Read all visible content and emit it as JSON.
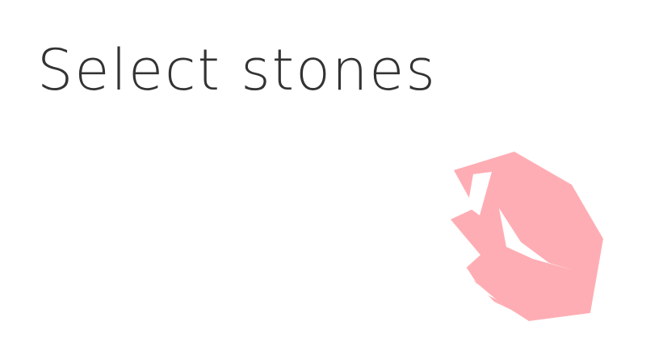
{
  "page": {
    "title": "Select stones"
  },
  "stone": {
    "icon": "pink-gemstone-icon",
    "color": "#ffadb4",
    "highlight_color": "#ffffff"
  }
}
